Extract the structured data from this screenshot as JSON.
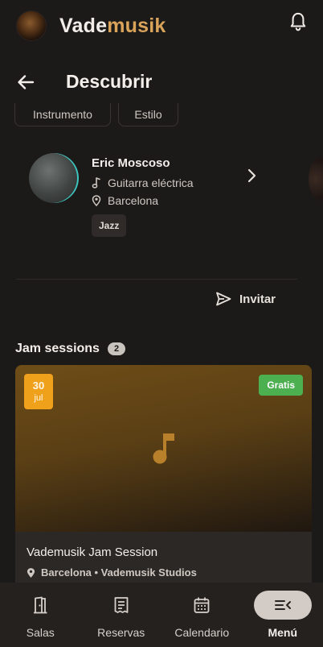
{
  "app": {
    "brand_part1": "Vade",
    "brand_part2": "musik",
    "colors": {
      "background": "#1c1a19",
      "brand_accent": "#d9a35a",
      "date_badge": "#f0a11c",
      "free_badge": "#4caf50"
    },
    "icons": {
      "logo": "band-logo-avatar",
      "notifications": "bell-icon"
    }
  },
  "header": {
    "title": "Descubrir",
    "back_icon": "arrow-left-icon"
  },
  "filters": [
    {
      "label": "Instrumento"
    },
    {
      "label": "Estilo"
    }
  ],
  "musician": {
    "name": "Eric Moscoso",
    "instrument": "Guitarra eléctrica",
    "city": "Barcelona",
    "tag": "Jazz"
  },
  "invite": {
    "label": "Invitar"
  },
  "jam_sessions": {
    "title": "Jam sessions",
    "count": "2",
    "event": {
      "day": "30",
      "month": "jul",
      "price_badge": "Gratis",
      "title": "Vademusik Jam Session",
      "location": "Barcelona • Vademusik Studios"
    }
  },
  "bottom_nav": [
    {
      "label": "Salas",
      "icon": "door-icon"
    },
    {
      "label": "Reservas",
      "icon": "receipt-icon"
    },
    {
      "label": "Calendario",
      "icon": "calendar-icon"
    },
    {
      "label": "Menú",
      "icon": "menu-collapse-icon",
      "active": true
    }
  ]
}
